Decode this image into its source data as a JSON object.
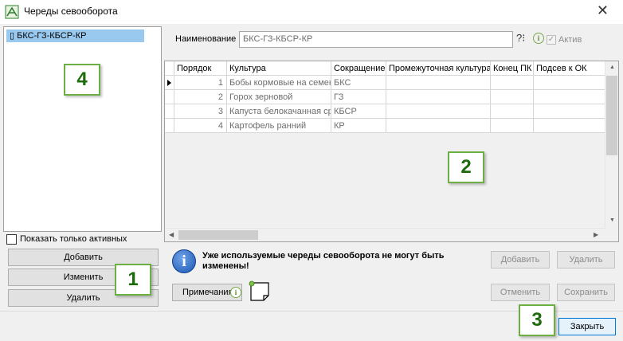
{
  "window": {
    "title": "Череды севооборота",
    "close_glyph": "✕",
    "icon": "excel-like-app-icon"
  },
  "left_panel": {
    "items": [
      {
        "prefix": "▯",
        "label": "БКС-ГЗ-КБСР-КР"
      }
    ],
    "show_active_only_label": "Показать только активных",
    "buttons": {
      "add": "Добавить",
      "edit": "Изменить",
      "delete": "Удалить"
    }
  },
  "form": {
    "name_label": "Наименование",
    "name_value": "БКС-ГЗ-КБСР-КР",
    "help_glyph": "?⁝",
    "info_glyph": "i",
    "active_label": "Актив",
    "active_check": "✓"
  },
  "grid": {
    "columns": [
      "Порядок",
      "Культура",
      "Сокращение",
      "Промежуточная культура",
      "Конец ПК",
      "Подсев к ОК"
    ],
    "rows": [
      {
        "order": "1",
        "culture": "Бобы кормовые на семена",
        "abbr": "БКС",
        "intermediate": "",
        "end_pk": "",
        "undersow": ""
      },
      {
        "order": "2",
        "culture": "Горох зерновой",
        "abbr": "ГЗ",
        "intermediate": "",
        "end_pk": "",
        "undersow": ""
      },
      {
        "order": "3",
        "culture": "Капуста белокачанная ср",
        "abbr": "КБСР",
        "intermediate": "",
        "end_pk": "",
        "undersow": ""
      },
      {
        "order": "4",
        "culture": "Картофель ранний",
        "abbr": "КР",
        "intermediate": "",
        "end_pk": "",
        "undersow": ""
      }
    ]
  },
  "info": {
    "glyph": "i",
    "message": "Уже используемые череды севооборота не могут быть изменены!"
  },
  "right_buttons": {
    "add": "Добавить",
    "delete": "Удалить",
    "cancel": "Отменить",
    "save": "Сохранить",
    "close": "Закрыть"
  },
  "notes_button": "Примечания",
  "callouts": [
    "1",
    "2",
    "3",
    "4"
  ]
}
